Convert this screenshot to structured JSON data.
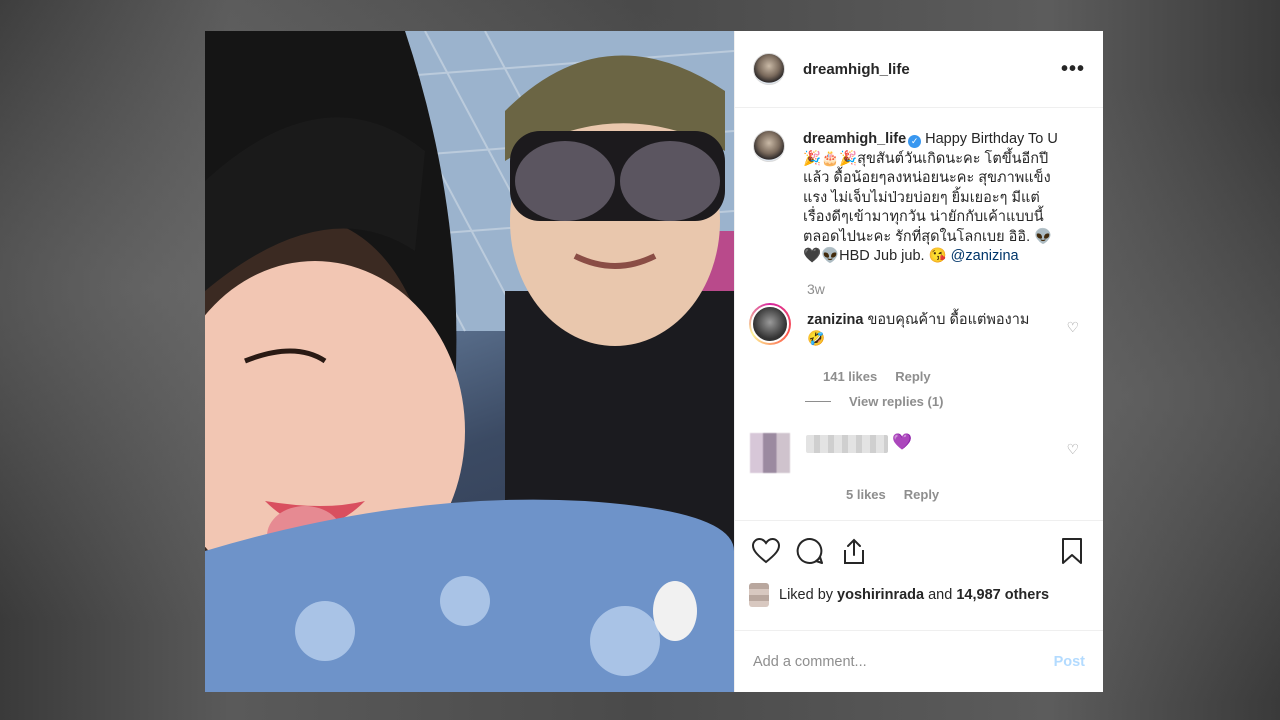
{
  "post": {
    "username": "dreamhigh_life",
    "more_icon": "more-dots-icon",
    "caption": {
      "username": "dreamhigh_life",
      "text": "Happy Birthday To U 🎉🎂🎉สุขสันต์วันเกิดนะคะ โตขึ้นอีกปีแล้ว ดื้อน้อยๆลงหน่อยนะคะ สุขภาพแข็งแรง ไม่เจ็บไม่ป่วยบ่อยๆ ยิ้มเยอะๆ มีแต่เรื่องดีๆเข้ามาทุกวัน น่ายักกับเค้าแบบนี้ตลอดไปนะคะ รักที่สุดในโลกเบย อิอิ. 👽🖤👽HBD Jub jub. 😘",
      "mention": "@zanizina"
    },
    "time_ago": "3w",
    "comments": [
      {
        "username": "zanizina",
        "text": "ขอบคุณค้าบ ดื้อแต่พองาม 🤣",
        "likes": "141 likes",
        "reply": "Reply",
        "view_replies": "View replies (1)"
      },
      {
        "text": "💜",
        "likes": "5 likes",
        "reply": "Reply"
      }
    ],
    "liked_by": {
      "prefix": "Liked by",
      "user": "yoshirinrada",
      "middle": "and",
      "others": "14,987 others"
    },
    "add_comment": {
      "placeholder": "Add a comment...",
      "post_label": "Post"
    },
    "colors": {
      "link": "#003569",
      "muted": "#8e8e8e",
      "verified": "#3897f0",
      "post_disabled": "#b3dbff"
    }
  }
}
